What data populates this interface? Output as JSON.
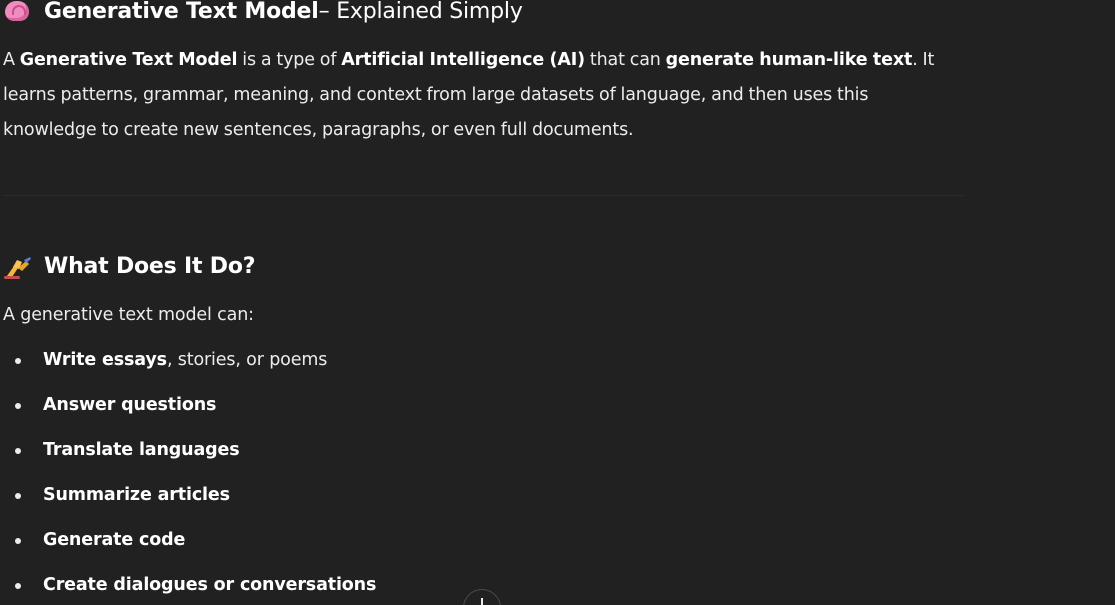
{
  "section1": {
    "emoji": "brain-icon",
    "title_bold": "Generative Text Model",
    "title_rest": " – Explained Simply",
    "paragraph": [
      {
        "text": "A ",
        "bold": false
      },
      {
        "text": "Generative Text Model",
        "bold": true
      },
      {
        "text": " is a type of ",
        "bold": false
      },
      {
        "text": "Artificial Intelligence (AI)",
        "bold": true
      },
      {
        "text": " that can ",
        "bold": false
      },
      {
        "text": "generate human-like text",
        "bold": true
      },
      {
        "text": ". It learns patterns, grammar, meaning, and context from large datasets of language, and then uses this knowledge to create new sentences, paragraphs, or even full documents.",
        "bold": false
      }
    ]
  },
  "section2": {
    "emoji": "writing-hand-icon",
    "title": "What Does It Do?",
    "intro": "A generative text model can:",
    "items": [
      {
        "bold": "Write essays",
        "rest": ", stories, or poems"
      },
      {
        "bold": "Answer questions",
        "rest": ""
      },
      {
        "bold": "Translate languages",
        "rest": ""
      },
      {
        "bold": "Summarize articles",
        "rest": ""
      },
      {
        "bold": "Generate code",
        "rest": ""
      },
      {
        "bold": "Create dialogues or conversations",
        "rest": ""
      }
    ]
  },
  "colors": {
    "background": "#212121",
    "text": "#ececec"
  }
}
